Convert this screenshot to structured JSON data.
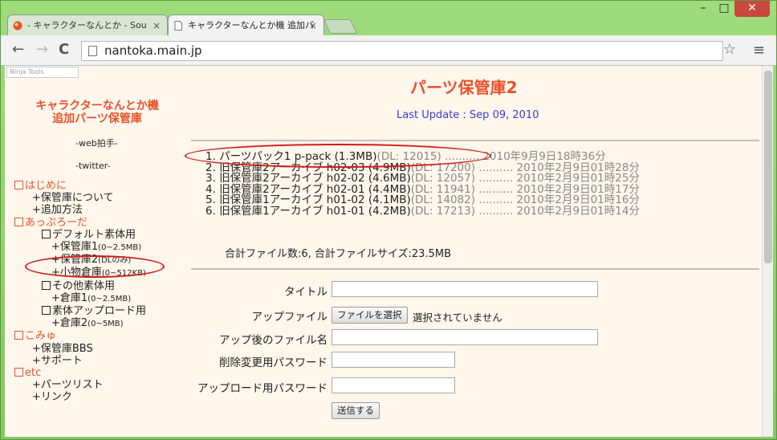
{
  "window": {
    "controls": {
      "minimize": "–",
      "maximize": "□",
      "close": "✕"
    }
  },
  "tabs": [
    {
      "label": "- キャラクターなんとか - Sou",
      "close": "×",
      "active": false
    },
    {
      "label": "キャラクターなんとか機 追加パ",
      "close": "×",
      "active": true
    }
  ],
  "toolbar": {
    "back": "←",
    "forward": "→",
    "reload": "C",
    "url": "nantoka.main.jp",
    "star": "☆",
    "menu": "≡"
  },
  "page": {
    "ninja": "Ninja Tools",
    "site_title": [
      "キャラクターなんとか機",
      "追加パーツ保管庫"
    ],
    "web_clap": "-web拍手-",
    "twitter": "-twitter-",
    "nav": {
      "s1": "はじめに",
      "s1_items": [
        "+保管庫について",
        "+追加方法"
      ],
      "s2": "あっぷろーだ",
      "g1": "デフォルト素体用",
      "g1_items": [
        {
          "label": "+保管庫1",
          "size": "(0~2.5MB)"
        },
        {
          "label": "+保管庫2",
          "size": "(DLのみ)"
        },
        {
          "label": "+小物倉庫",
          "size": "(0~512KB)"
        }
      ],
      "g2": "その他素体用",
      "g2_items": [
        {
          "label": "+倉庫1",
          "size": "(0~2.5MB)"
        }
      ],
      "g3": "素体アップロード用",
      "g3_items": [
        {
          "label": "+倉庫2",
          "size": "(0~5MB)"
        }
      ],
      "s3": "こみゅ",
      "s3_items": [
        "+保管庫BBS",
        "+サポート"
      ],
      "s4": "etc",
      "s4_items": [
        "+パーツリスト",
        "+リンク"
      ]
    },
    "title": "パーツ保管庫2",
    "last_update": "Last Update : Sep 09, 2010",
    "files": [
      {
        "num": "1.",
        "name": "パーツパック1 p-pack",
        "size": "(1.3MB)",
        "dl": "(DL: 12015)",
        "dots": "..........",
        "date": "2010年9月9日18時36分"
      },
      {
        "num": "2.",
        "name": "旧保管庫2アーカイブ h02-03",
        "size": "(4.9MB)",
        "dl": "(DL: 17200)",
        "dots": "..........",
        "date": "2010年2月9日01時28分"
      },
      {
        "num": "3.",
        "name": "旧保管庫2アーカイブ h02-02",
        "size": "(4.6MB)",
        "dl": "(DL: 12057)",
        "dots": "..........",
        "date": "2010年2月9日01時25分"
      },
      {
        "num": "4.",
        "name": "旧保管庫2アーカイブ h02-01",
        "size": "(4.4MB)",
        "dl": "(DL: 11941)",
        "dots": "..........",
        "date": "2010年2月9日01時17分"
      },
      {
        "num": "5.",
        "name": "旧保管庫1アーカイブ h01-02",
        "size": "(4.1MB)",
        "dl": "(DL: 14082)",
        "dots": "..........",
        "date": "2010年2月9日01時16分"
      },
      {
        "num": "6.",
        "name": "旧保管庫1アーカイブ h01-01",
        "size": "(4.2MB)",
        "dl": "(DL: 17213)",
        "dots": "..........",
        "date": "2010年2月9日01時14分"
      }
    ],
    "total": "合計ファイル数:6, 合計ファイルサイズ:23.5MB",
    "form": {
      "title_label": "タイトル",
      "file_label": "アップファイル",
      "file_button": "ファイルを選択",
      "no_file": "選択されていません",
      "filename_label": "アップ後のファイル名",
      "delete_pw_label": "削除変更用パスワード",
      "upload_pw_label": "アップロード用パスワード",
      "submit": "送信する"
    }
  },
  "colors": {
    "accent": "#e8522a",
    "link_blue": "#3b3bd6",
    "annotation_red": "#d21a1a",
    "page_bg": "#fff6ec"
  }
}
